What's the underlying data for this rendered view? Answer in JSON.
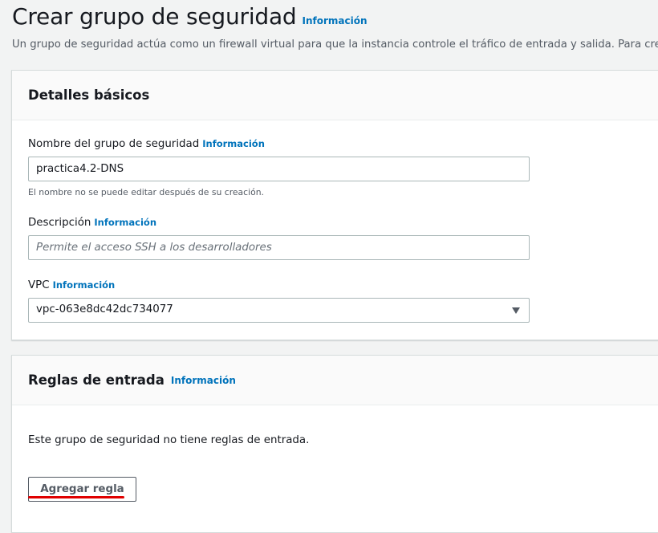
{
  "page": {
    "title": "Crear grupo de seguridad",
    "title_info": "Información",
    "description": "Un grupo de seguridad actúa como un firewall virtual para que la instancia controle el tráfico de entrada y salida. Para crear un"
  },
  "basic_details": {
    "title": "Detalles básicos",
    "name_field": {
      "label": "Nombre del grupo de seguridad",
      "info": "Información",
      "value": "practica4.2-DNS",
      "hint": "El nombre no se puede editar después de su creación."
    },
    "description_field": {
      "label": "Descripción",
      "info": "Información",
      "value": "",
      "placeholder": "Permite el acceso SSH a los desarrolladores"
    },
    "vpc_field": {
      "label": "VPC",
      "info": "Información",
      "selected": "vpc-063e8dc42dc734077",
      "caret_icon": "caret-down-icon"
    }
  },
  "inbound_rules": {
    "title": "Reglas de entrada",
    "info": "Información",
    "empty_message": "Este grupo de seguridad no tiene reglas de entrada.",
    "add_rule_label": "Agregar regla"
  },
  "colors": {
    "link": "#0073bb",
    "annotation_underline": "#e00000"
  }
}
